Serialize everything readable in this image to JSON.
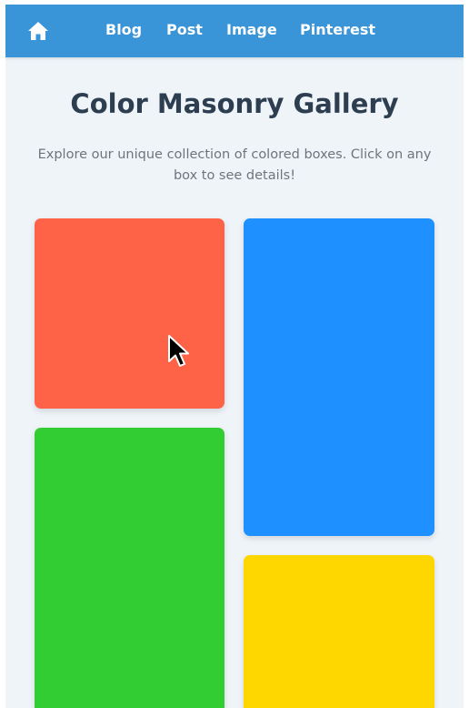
{
  "nav": {
    "home_icon": "home-icon",
    "links": [
      {
        "label": "Blog"
      },
      {
        "label": "Post"
      },
      {
        "label": "Image"
      },
      {
        "label": "Pinterest"
      }
    ],
    "background": "#3a95d8"
  },
  "page": {
    "title": "Color Masonry Gallery",
    "subtitle": "Explore our unique collection of colored boxes. Click on any box to see details!"
  },
  "gallery": {
    "boxes": [
      {
        "color": "#ff6347"
      },
      {
        "color": "#1e90ff"
      },
      {
        "color": "#32cd32"
      },
      {
        "color": "#ffd700"
      }
    ]
  },
  "cursor": "pointer-arrow-icon"
}
